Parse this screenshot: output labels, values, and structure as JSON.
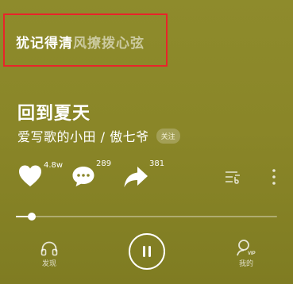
{
  "lyric": {
    "sung": "犹记得清",
    "unsung": "风撩拨心弦"
  },
  "song": {
    "title": "回到夏天",
    "artist": "爱写歌的小田 / 傲七爷",
    "follow_label": "关注"
  },
  "actions": {
    "like_count": "4.8w",
    "comment_count": "289",
    "share_count": "381"
  },
  "progress": {
    "fraction": 0.06
  },
  "nav": {
    "discover_label": "发现",
    "mine_label": "我的",
    "vip_badge": "VIP"
  },
  "colors": {
    "background": "#8a8628",
    "highlight_box": "#e8242a",
    "text": "#ffffff"
  },
  "icons": [
    "heart-icon",
    "comment-icon",
    "share-icon",
    "playlist-icon",
    "more-icon",
    "headphones-icon",
    "pause-icon",
    "user-vip-icon"
  ]
}
